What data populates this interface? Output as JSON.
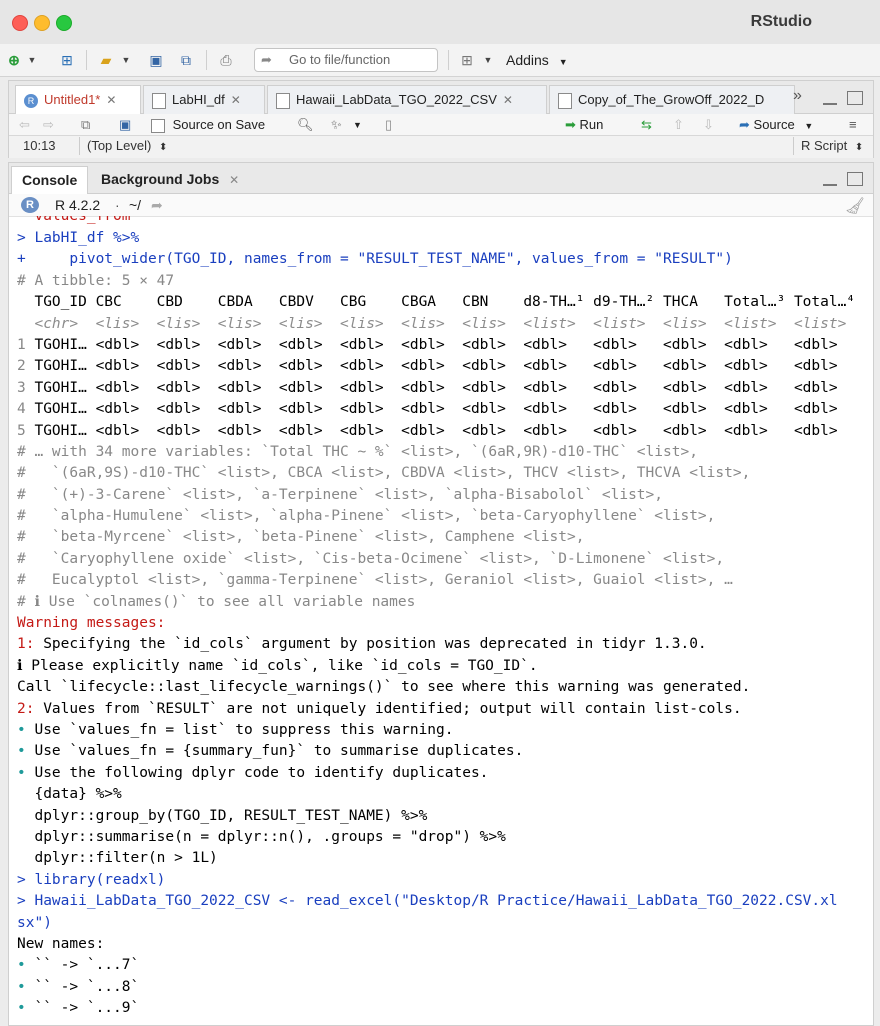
{
  "app": {
    "title": "RStudio"
  },
  "toolbar": {
    "goto_placeholder": "Go to file/function",
    "addins_label": "Addins"
  },
  "editor": {
    "tabs": [
      {
        "label": "Untitled1*",
        "active": true
      },
      {
        "label": "LabHI_df",
        "active": false
      },
      {
        "label": "Hawaii_LabData_TGO_2022_CSV",
        "active": false
      },
      {
        "label": "Copy_of_The_GrowOff_2022_D",
        "active": false
      }
    ],
    "more_tabs": "»",
    "source_on_save": "Source on Save",
    "run_label": "Run",
    "source_label": "Source",
    "cursor_pos": "10:13",
    "scope": "(Top Level)",
    "file_type": "R Script"
  },
  "console": {
    "tabs": [
      {
        "label": "Console"
      },
      {
        "label": "Background Jobs"
      }
    ],
    "r_version": "R 4.2.2",
    "wd": "~/",
    "lines": [
      {
        "text": "  values_from",
        "cls": "red",
        "half": true
      },
      {
        "text": "> LabHI_df %>%",
        "cls": "prompt"
      },
      {
        "text": "+     pivot_wider(TGO_ID, names_from = \"RESULT_TEST_NAME\", values_from = \"RESULT\")",
        "cls": "prompt"
      },
      {
        "text": "# A tibble: 5 × 47",
        "cls": "cmt"
      },
      {
        "text": "  TGO_ID CBC    CBD    CBDA   CBDV   CBG    CBGA   CBN    d8-TH…¹ d9-TH…² THCA   Total…³ Total…⁴",
        "cls": ""
      },
      {
        "text": "  <chr>  <lis>  <lis>  <lis>  <lis>  <lis>  <lis>  <lis>  <list>  <list>  <lis>  <list>  <list>",
        "cls": "tag"
      },
      {
        "text": "1 TGOHI… <dbl>  <dbl>  <dbl>  <dbl>  <dbl>  <dbl>  <dbl>  <dbl>   <dbl>   <dbl>  <dbl>   <dbl>",
        "cls": "",
        "rowno": true
      },
      {
        "text": "2 TGOHI… <dbl>  <dbl>  <dbl>  <dbl>  <dbl>  <dbl>  <dbl>  <dbl>   <dbl>   <dbl>  <dbl>   <dbl>",
        "cls": "",
        "rowno": true
      },
      {
        "text": "3 TGOHI… <dbl>  <dbl>  <dbl>  <dbl>  <dbl>  <dbl>  <dbl>  <dbl>   <dbl>   <dbl>  <dbl>   <dbl>",
        "cls": "",
        "rowno": true
      },
      {
        "text": "4 TGOHI… <dbl>  <dbl>  <dbl>  <dbl>  <dbl>  <dbl>  <dbl>  <dbl>   <dbl>   <dbl>  <dbl>   <dbl>",
        "cls": "",
        "rowno": true
      },
      {
        "text": "5 TGOHI… <dbl>  <dbl>  <dbl>  <dbl>  <dbl>  <dbl>  <dbl>  <dbl>   <dbl>   <dbl>  <dbl>   <dbl>",
        "cls": "",
        "rowno": true
      },
      {
        "text": "# … with 34 more variables: `Total THC ~ %` <list>, `(6aR,9R)-d10-THC` <list>,",
        "cls": "cmt"
      },
      {
        "text": "#   `(6aR,9S)-d10-THC` <list>, CBCA <list>, CBDVA <list>, THCV <list>, THCVA <list>,",
        "cls": "cmt"
      },
      {
        "text": "#   `(+)-3-Carene` <list>, `a-Terpinene` <list>, `alpha-Bisabolol` <list>,",
        "cls": "cmt"
      },
      {
        "text": "#   `alpha-Humulene` <list>, `alpha-Pinene` <list>, `beta-Caryophyllene` <list>,",
        "cls": "cmt"
      },
      {
        "text": "#   `beta-Myrcene` <list>, `beta-Pinene` <list>, Camphene <list>,",
        "cls": "cmt"
      },
      {
        "text": "#   `Caryophyllene oxide` <list>, `Cis-beta-Ocimene` <list>, `D-Limonene` <list>,",
        "cls": "cmt"
      },
      {
        "text": "#   Eucalyptol <list>, `gamma-Terpinene` <list>, Geraniol <list>, Guaiol <list>, …",
        "cls": "cmt"
      },
      {
        "text": "# ℹ Use `colnames()` to see all variable names",
        "cls": "cmt"
      },
      {
        "text": "Warning messages:",
        "cls": "red"
      },
      {
        "text": "1: Specifying the `id_cols` argument by position was deprecated in tidyr 1.3.0.",
        "cls": "",
        "num": "1:"
      },
      {
        "text": "ℹ Please explicitly name `id_cols`, like `id_cols = TGO_ID`.",
        "cls": ""
      },
      {
        "text": "Call `lifecycle::last_lifecycle_warnings()` to see where this warning was generated.",
        "cls": ""
      },
      {
        "text": "2: Values from `RESULT` are not uniquely identified; output will contain list-cols.",
        "cls": "",
        "num": "2:"
      },
      {
        "text": "• Use `values_fn = list` to suppress this warning.",
        "cls": "",
        "bullet": true
      },
      {
        "text": "• Use `values_fn = {summary_fun}` to summarise duplicates.",
        "cls": "",
        "bullet": true
      },
      {
        "text": "• Use the following dplyr code to identify duplicates.",
        "cls": "",
        "bullet": true
      },
      {
        "text": "  {data} %>%",
        "cls": ""
      },
      {
        "text": "  dplyr::group_by(TGO_ID, RESULT_TEST_NAME) %>%",
        "cls": ""
      },
      {
        "text": "  dplyr::summarise(n = dplyr::n(), .groups = \"drop\") %>%",
        "cls": ""
      },
      {
        "text": "  dplyr::filter(n > 1L)",
        "cls": ""
      },
      {
        "text": "> library(readxl)",
        "cls": "prompt"
      },
      {
        "text": "> Hawaii_LabData_TGO_2022_CSV <- read_excel(\"Desktop/R Practice/Hawaii_LabData_TGO_2022.CSV.xl",
        "cls": "prompt"
      },
      {
        "text": "sx\")",
        "cls": "prompt"
      },
      {
        "text": "New names:",
        "cls": ""
      },
      {
        "text": "• `` -> `...7`",
        "cls": "",
        "bullet": true
      },
      {
        "text": "• `` -> `...8`",
        "cls": "",
        "bullet": true
      },
      {
        "text": "• `` -> `...9`",
        "cls": "",
        "bullet": true
      }
    ]
  }
}
